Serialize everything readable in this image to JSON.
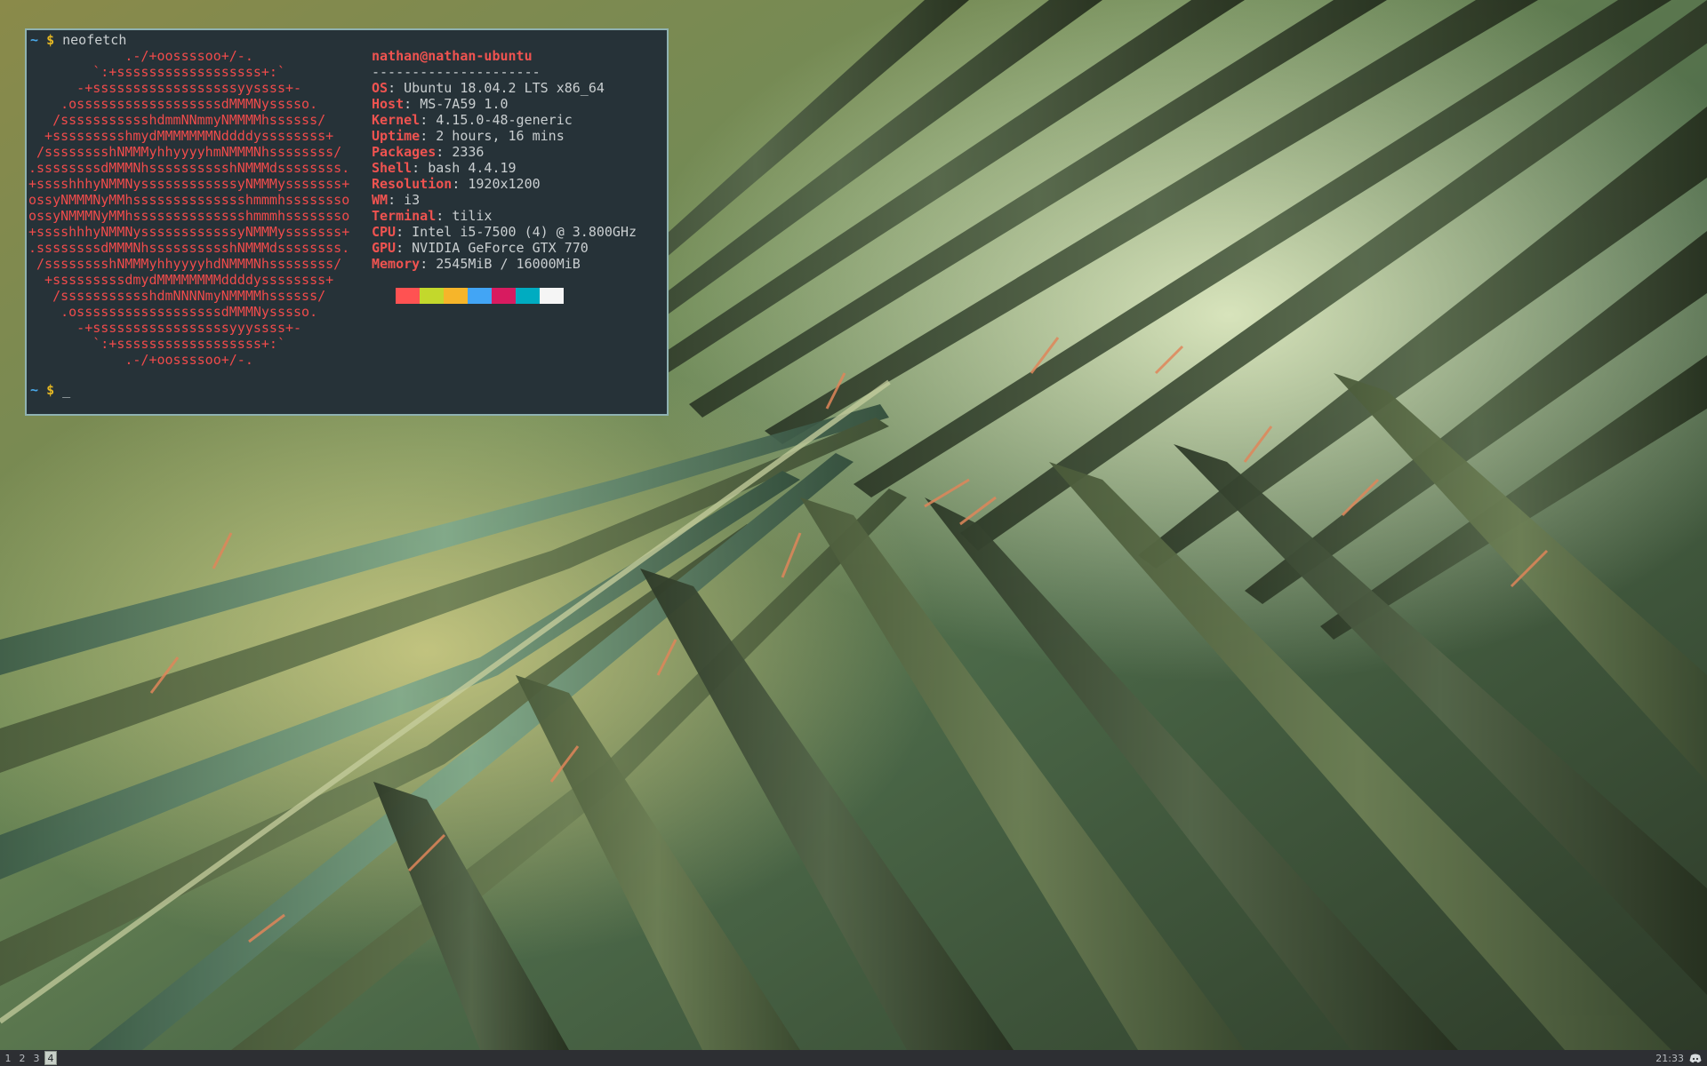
{
  "terminal": {
    "prompt_tilde": "~",
    "prompt_symbol": "$",
    "command": "neofetch",
    "logo_ascii": "            .-/+oossssoo+/-.\n        `:+ssssssssssssssssss+:`\n      -+ssssssssssssssssssyyssss+-\n    .ossssssssssssssssssdMMMNysssso.\n   /ssssssssssshdmmNNmmyNMMMMhssssss/\n  +ssssssssshmydMMMMMMMNddddyssssssss+\n /sssssssshNMMMyhhyyyyhmNMMMNhssssssss/\n.ssssssssdMMMNhsssssssssshNMMMdssssssss.\n+sssshhhyNMMNyssssssssssssyNMMMysssssss+\nossyNMMMNyMMhsssssssssssssshmmmhssssssso\nossyNMMMNyMMhsssssssssssssshmmmhssssssso\n+sssshhhyNMMNyssssssssssssyNMMMysssssss+\n.ssssssssdMMMNhsssssssssshNMMMdssssssss.\n /sssssssshNMMMyhhyyyyhdNMMMNhssssssss/\n  +sssssssssdmydMMMMMMMMddddyssssssss+\n   /ssssssssssshdmNNNNmyNMMMMhssssss/\n    .ossssssssssssssssssdMMMNysssso.\n      -+sssssssssssssssssyyyssss+-\n        `:+ssssssssssssssssss+:`\n            .-/+oossssoo+/-.",
    "user": "nathan",
    "at": "@",
    "host": "nathan-ubuntu",
    "separator": "---------------------",
    "info": [
      {
        "key": "OS",
        "value": "Ubuntu 18.04.2 LTS x86_64"
      },
      {
        "key": "Host",
        "value": "MS-7A59 1.0"
      },
      {
        "key": "Kernel",
        "value": "4.15.0-48-generic"
      },
      {
        "key": "Uptime",
        "value": "2 hours, 16 mins"
      },
      {
        "key": "Packages",
        "value": "2336"
      },
      {
        "key": "Shell",
        "value": "bash 4.4.19"
      },
      {
        "key": "Resolution",
        "value": "1920x1200"
      },
      {
        "key": "WM",
        "value": "i3"
      },
      {
        "key": "Terminal",
        "value": "tilix"
      },
      {
        "key": "CPU",
        "value": "Intel i5-7500 (4) @ 3.800GHz"
      },
      {
        "key": "GPU",
        "value": "NVIDIA GeForce GTX 770"
      },
      {
        "key": "Memory",
        "value": "2545MiB / 16000MiB"
      }
    ],
    "key_suffix": ":",
    "color_swatches": [
      "#263238",
      "#ff5252",
      "#c3d82c",
      "#f6b52a",
      "#42a5f5",
      "#d81b60",
      "#00acc1",
      "#f5f5f5"
    ],
    "cursor_char": "_"
  },
  "bar": {
    "workspaces": [
      {
        "label": "1",
        "active": false
      },
      {
        "label": "2",
        "active": false
      },
      {
        "label": "3",
        "active": false
      },
      {
        "label": "4",
        "active": true
      }
    ],
    "clock": "21:33",
    "tray_icon": "discord-icon"
  },
  "colors": {
    "terminal_bg": "#263238",
    "terminal_border": "#8fb2b2",
    "accent_red": "#ef5350",
    "bar_bg": "#2d2f33"
  }
}
